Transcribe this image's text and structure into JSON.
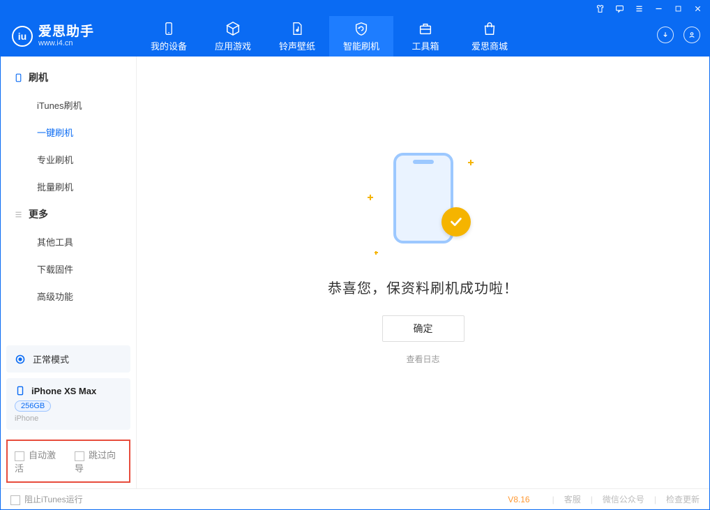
{
  "app": {
    "name": "爱思助手",
    "site": "www.i4.cn",
    "version": "V8.16"
  },
  "nav": [
    {
      "id": "device",
      "label": "我的设备"
    },
    {
      "id": "apps",
      "label": "应用游戏"
    },
    {
      "id": "media",
      "label": "铃声壁纸"
    },
    {
      "id": "flash",
      "label": "智能刷机",
      "active": true
    },
    {
      "id": "tools",
      "label": "工具箱"
    },
    {
      "id": "store",
      "label": "爱思商城"
    }
  ],
  "sidebar": {
    "groups": [
      {
        "title": "刷机",
        "icon": "phone-icon",
        "items": [
          {
            "id": "itunes",
            "label": "iTunes刷机"
          },
          {
            "id": "oneclick",
            "label": "一键刷机",
            "active": true
          },
          {
            "id": "pro",
            "label": "专业刷机"
          },
          {
            "id": "batch",
            "label": "批量刷机"
          }
        ]
      },
      {
        "title": "更多",
        "icon": "list-icon",
        "items": [
          {
            "id": "other",
            "label": "其他工具"
          },
          {
            "id": "fw",
            "label": "下载固件"
          },
          {
            "id": "adv",
            "label": "高级功能"
          }
        ]
      }
    ],
    "mode_label": "正常模式",
    "device": {
      "name": "iPhone XS Max",
      "capacity": "256GB",
      "type": "iPhone"
    },
    "options": {
      "auto_activate": "自动激活",
      "skip_wizard": "跳过向导"
    }
  },
  "main": {
    "message": "恭喜您，保资料刷机成功啦！",
    "ok_label": "确定",
    "log_link": "查看日志"
  },
  "footer": {
    "block_itunes": "阻止iTunes运行",
    "links": {
      "support": "客服",
      "wechat": "微信公众号",
      "update": "检查更新"
    }
  }
}
